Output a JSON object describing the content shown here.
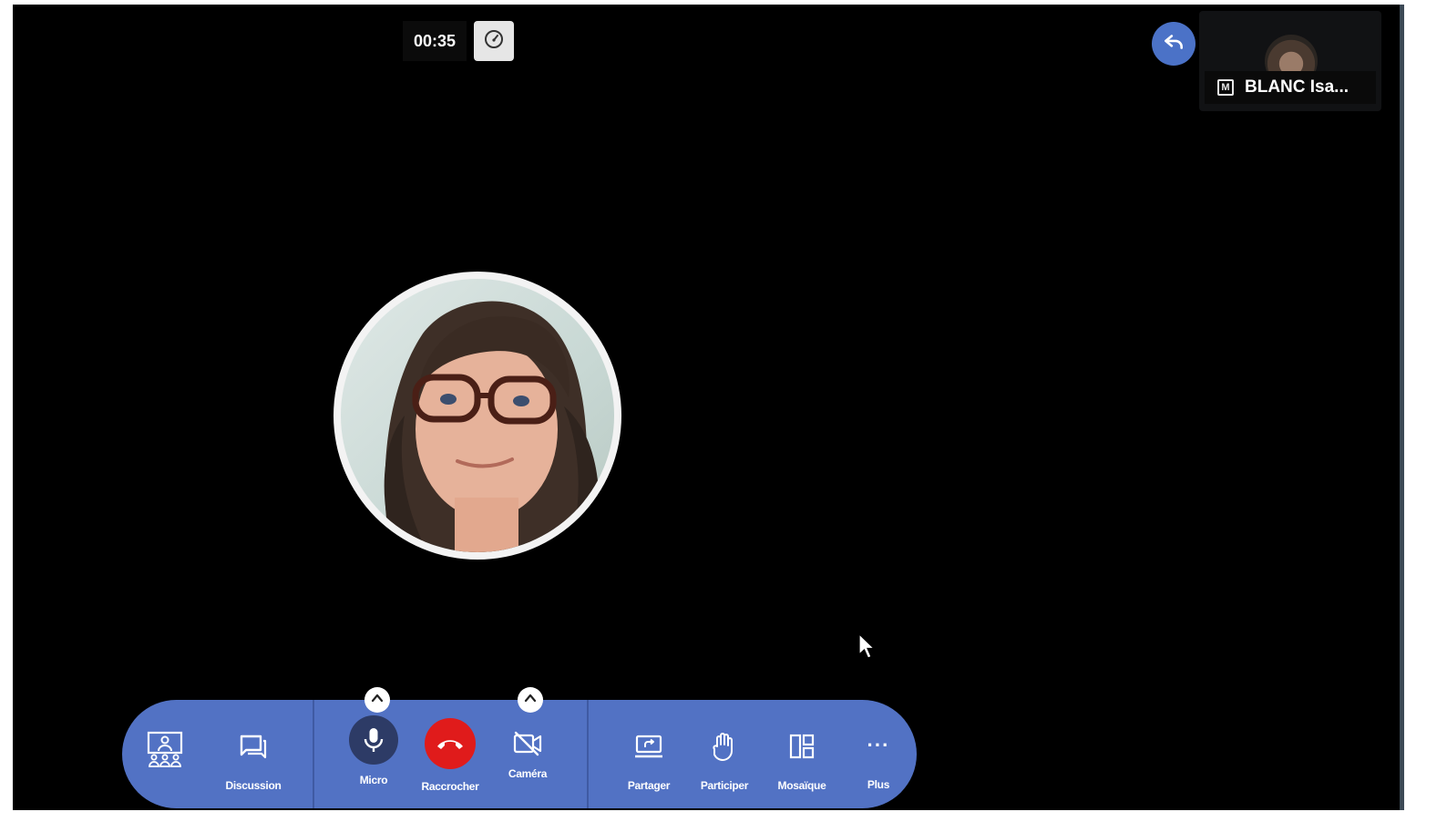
{
  "call": {
    "timer": "00:35",
    "participant_name": "BLANC Isa...",
    "participant_badge": "M"
  },
  "toolbar": {
    "participants_label": "",
    "discussion_label": "Discussion",
    "micro_label": "Micro",
    "hangup_label": "Raccrocher",
    "camera_label": "Caméra",
    "share_label": "Partager",
    "raise_hand_label": "Participer",
    "mosaic_label": "Mosaïque",
    "more_label": "Plus",
    "more_icon_text": "···"
  },
  "colors": {
    "toolbar_bg": "#5272c4",
    "mic_active_bg": "#2d3b66",
    "hangup_bg": "#e01b1b",
    "back_btn_bg": "#4b72c7"
  },
  "icons": {
    "stats": "gauge-icon",
    "back": "reply-arrow-icon",
    "participants": "participants-icon",
    "discussion": "chat-icon",
    "micro": "microphone-icon",
    "hangup": "phone-hangup-icon",
    "camera": "camera-off-icon",
    "share": "screen-share-icon",
    "raise_hand": "hand-icon",
    "mosaic": "mosaic-layout-icon",
    "more": "more-dots-icon"
  }
}
